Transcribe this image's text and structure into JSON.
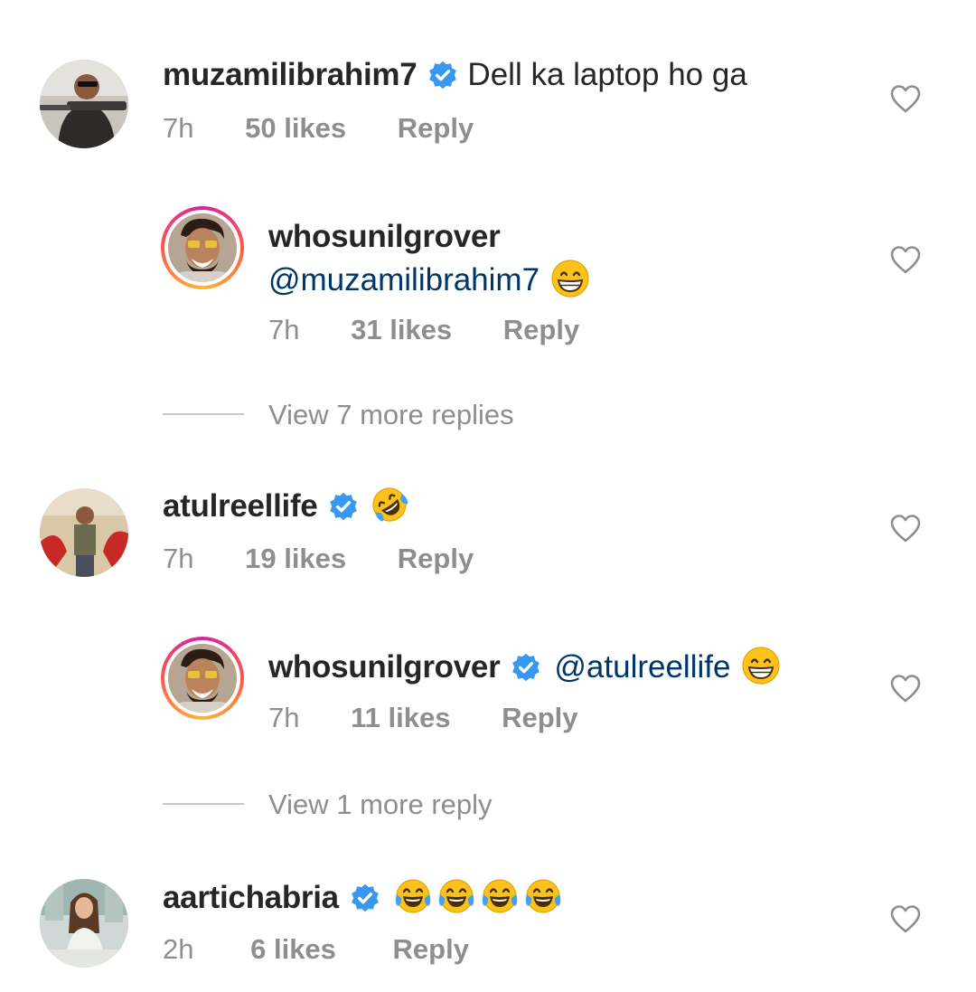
{
  "comments": [
    {
      "username": "muzamilibrahim7",
      "text": "Dell ka laptop ho ga",
      "time": "7h",
      "likes": "50 likes",
      "reply": "Reply"
    },
    {
      "username": "whosunilgrover",
      "mention": "@muzamilibrahim7",
      "time": "7h",
      "likes": "31 likes",
      "reply": "Reply"
    },
    {
      "username": "atulreellife",
      "time": "7h",
      "likes": "19 likes",
      "reply": "Reply"
    },
    {
      "username": "whosunilgrover",
      "mention": "@atulreellife",
      "time": "7h",
      "likes": "11 likes",
      "reply": "Reply"
    },
    {
      "username": "aartichabria",
      "time": "2h",
      "likes": "6 likes",
      "reply": "Reply"
    }
  ],
  "view_replies": [
    "View 7 more replies",
    "View 1 more reply"
  ],
  "icons": {
    "verified": "verified-badge-icon",
    "like": "heart-outline-icon",
    "grin": "grinning-face-emoji",
    "rofl": "rolling-on-floor-laughing-emoji",
    "joy": "face-with-tears-of-joy-emoji"
  },
  "colors": {
    "verified": "#3897f0",
    "mention": "#003569",
    "meta": "#8e8e8e"
  }
}
